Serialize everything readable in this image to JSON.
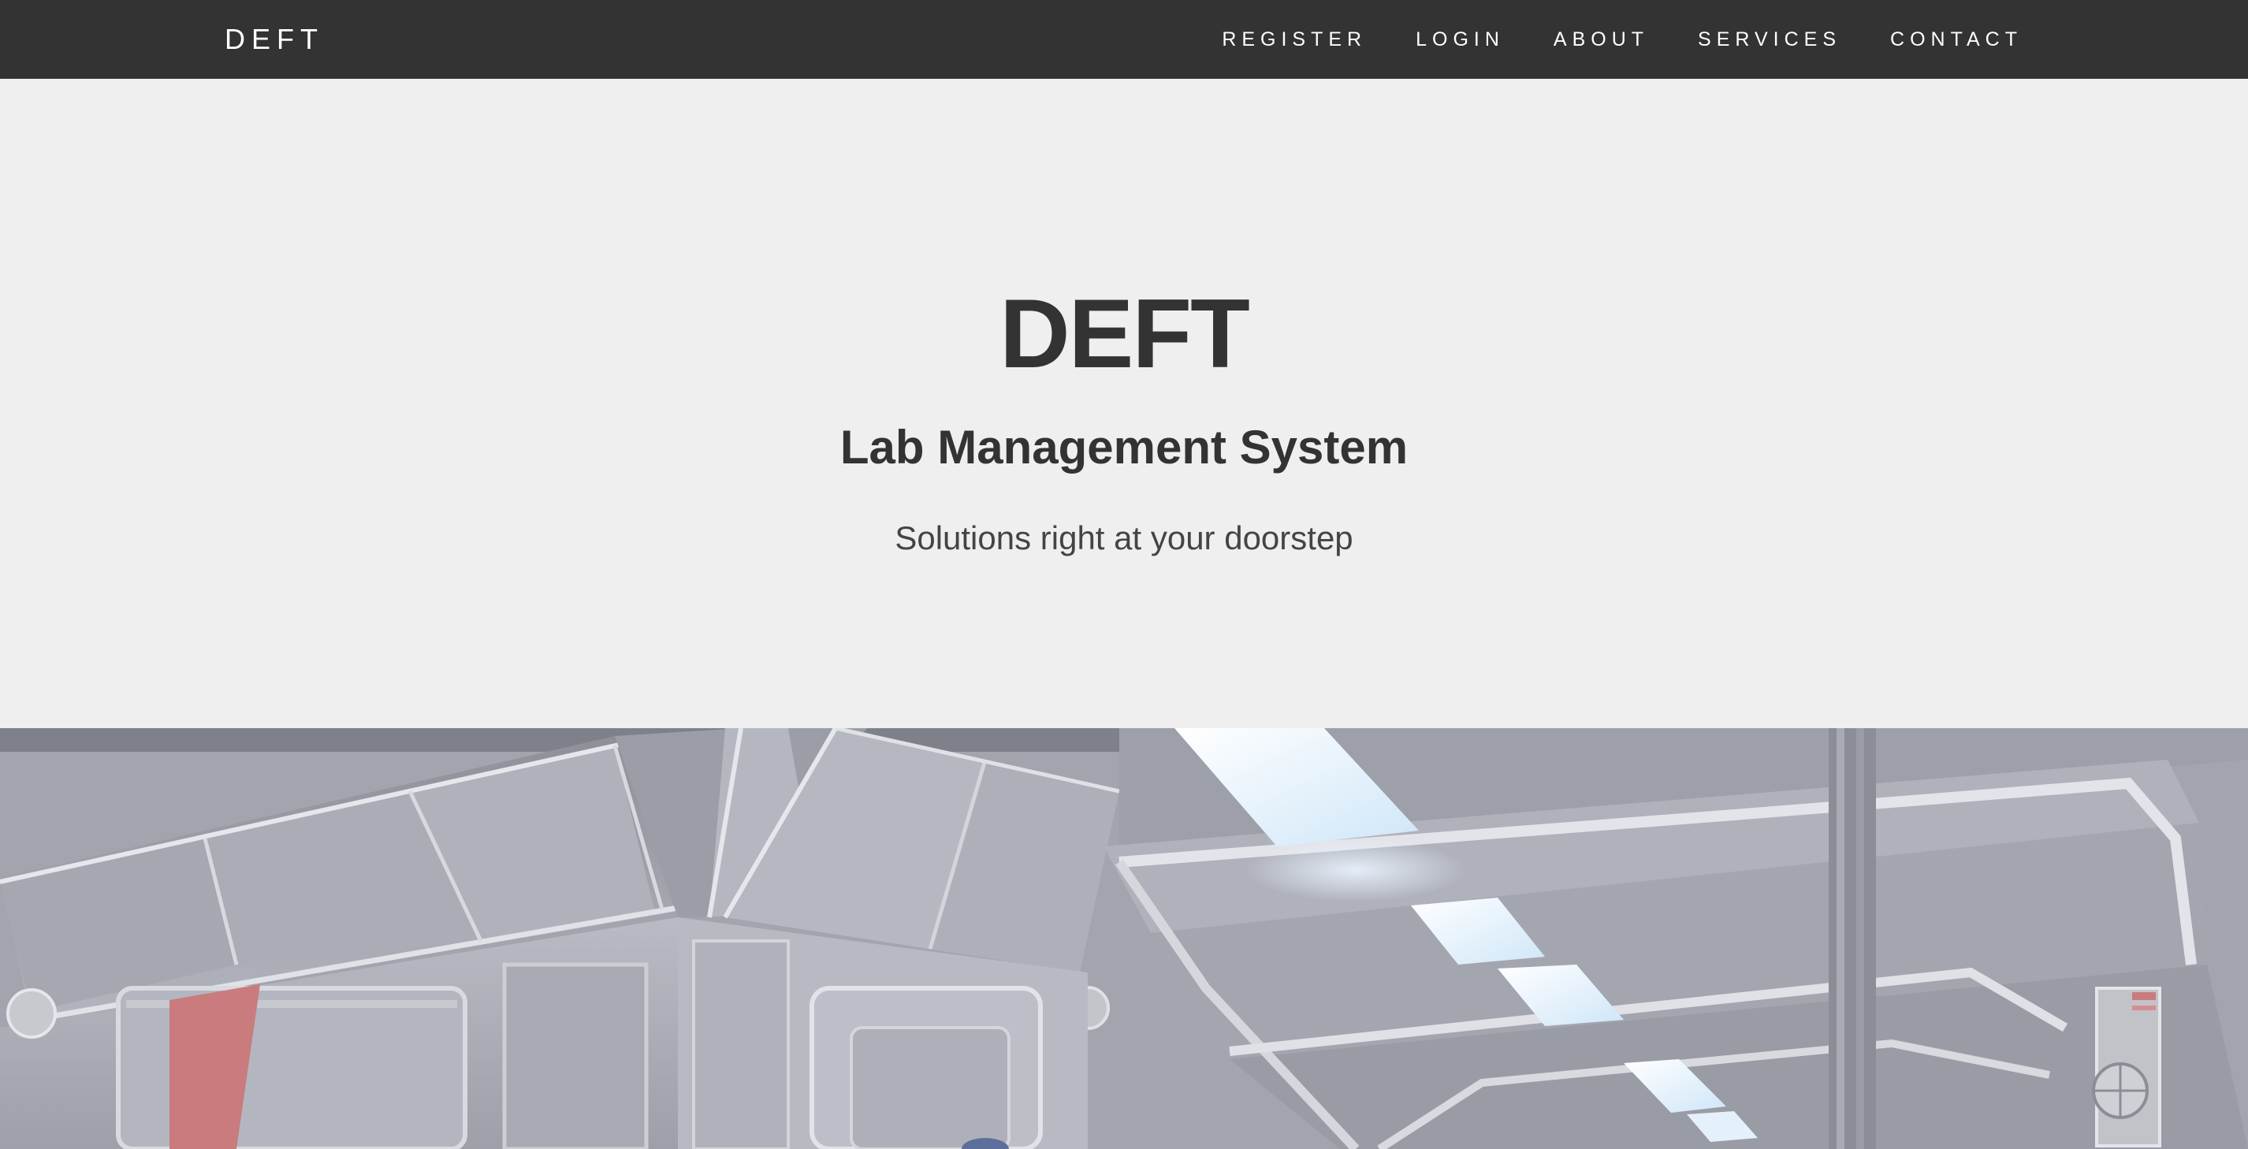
{
  "navbar": {
    "brand": "DEFT",
    "links": [
      {
        "label": "REGISTER"
      },
      {
        "label": "LOGIN"
      },
      {
        "label": "ABOUT"
      },
      {
        "label": "SERVICES"
      },
      {
        "label": "CONTACT"
      }
    ]
  },
  "hero": {
    "title": "DEFT",
    "subtitle": "Lab Management System",
    "tagline": "Solutions right at your doorstep"
  },
  "colors": {
    "navbar_bg": "#333333",
    "page_bg": "#efefef",
    "text_dark": "#333333"
  }
}
